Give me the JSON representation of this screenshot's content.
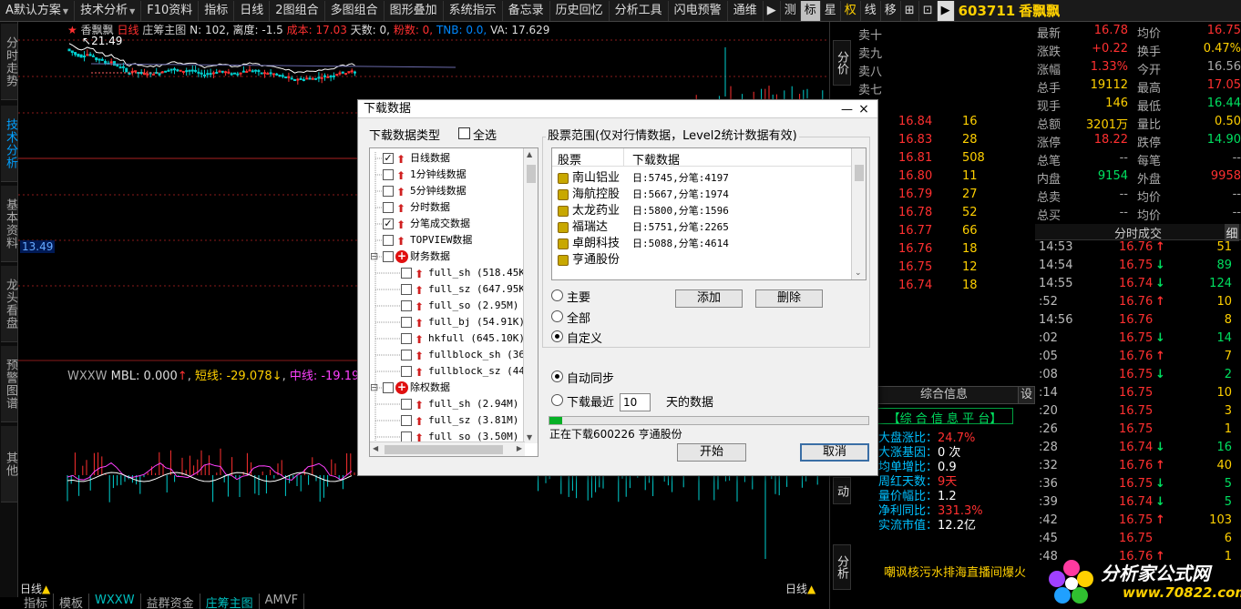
{
  "toolbar": {
    "items": [
      "A默认方案",
      "技术分析",
      "F10资料",
      "指标",
      "日线",
      "2图组合",
      "多图组合",
      "图形叠加",
      "系统指示",
      "备忘录",
      "历史回忆",
      "分析工具",
      "闪电预警",
      "通维"
    ],
    "mode_buttons": [
      "测",
      "标",
      "星",
      "权",
      "线",
      "移"
    ],
    "stock_code": "603711",
    "stock_name": "香飘飘"
  },
  "left_tabs": [
    "分时走势",
    "技术分析",
    "基本资料",
    "龙头看盘",
    "预警图谱",
    "其他"
  ],
  "chart": {
    "legend": {
      "name": "香飘飘",
      "period": "日线",
      "indicator": "庄筹主图",
      "n": "N: 102,",
      "height": "离度: -1.5",
      "cost": "成本: 17.03",
      "days": "天数: 0,",
      "fans": "粉数: 0,",
      "tnb": "TNB: 0.0,",
      "va": "VA: 17.629"
    },
    "high_label": "21.49",
    "left_price": "13.49",
    "ind_legend": {
      "name": "WXXW",
      "mbl": "MBL: 0.000",
      "short": "短线: -29.078",
      "mid": "中线: -19.194"
    },
    "period_label": "日线",
    "colors": {
      "up": "#ff3030",
      "down": "#00d0d0",
      "ma": "#ffffff",
      "grid": "#8a1a1a"
    }
  },
  "bottom_tabs": [
    "指标",
    "模板",
    "WXXW",
    "益群资金",
    "庄筹主图",
    "AMVF"
  ],
  "axis_labels": [
    "分价",
    "动",
    "分析"
  ],
  "orderbook": {
    "sell_labels": [
      "卖十",
      "卖九",
      "卖八",
      "卖七"
    ],
    "rows": [
      {
        "price": "16.84",
        "vol": "16"
      },
      {
        "price": "16.83",
        "vol": "28"
      },
      {
        "price": "16.81",
        "vol": "508"
      },
      {
        "price": "16.80",
        "vol": "11"
      },
      {
        "price": "16.79",
        "vol": "27"
      },
      {
        "price": "16.78",
        "vol": "52"
      },
      {
        "price": "16.77",
        "vol": "66"
      },
      {
        "price": "16.76",
        "vol": "18"
      },
      {
        "price": "16.75",
        "vol": "12"
      },
      {
        "price": "16.74",
        "vol": "18"
      }
    ]
  },
  "quote": {
    "rows": [
      {
        "l1": "最新",
        "v1": "16.78",
        "c1": "#ff3030",
        "l2": "均价",
        "v2": "16.75",
        "c2": "#ff3030"
      },
      {
        "l1": "涨跌",
        "v1": "+0.22",
        "c1": "#ff3030",
        "l2": "换手",
        "v2": "0.47%",
        "c2": "#ffd000"
      },
      {
        "l1": "涨幅",
        "v1": "1.33%",
        "c1": "#ff3030",
        "l2": "今开",
        "v2": "16.56",
        "c2": "#aaaaaa"
      },
      {
        "l1": "总手",
        "v1": "19112",
        "c1": "#ffd000",
        "l2": "最高",
        "v2": "17.05",
        "c2": "#ff3030"
      },
      {
        "l1": "现手",
        "v1": "146",
        "c1": "#ffd000",
        "l2": "最低",
        "v2": "16.44",
        "c2": "#00e060"
      },
      {
        "l1": "总额",
        "v1": "3201万",
        "c1": "#ffd000",
        "l2": "量比",
        "v2": "0.50",
        "c2": "#ffd000"
      },
      {
        "l1": "涨停",
        "v1": "18.22",
        "c1": "#ff3030",
        "l2": "跌停",
        "v2": "14.90",
        "c2": "#00e060"
      },
      {
        "l1": "总笔",
        "v1": "--",
        "c1": "#aaaaaa",
        "l2": "每笔",
        "v2": "--",
        "c2": "#aaaaaa"
      },
      {
        "l1": "内盘",
        "v1": "9154",
        "c1": "#00e060",
        "l2": "外盘",
        "v2": "9958",
        "c2": "#ff3030"
      },
      {
        "l1": "总卖",
        "v1": "--",
        "c1": "#aaaaaa",
        "l2": "均价",
        "v2": "--",
        "c2": "#aaaaaa"
      },
      {
        "l1": "总买",
        "v1": "--",
        "c1": "#aaaaaa",
        "l2": "均价",
        "v2": "--",
        "c2": "#aaaaaa"
      }
    ]
  },
  "ticks": {
    "title": "分时成交",
    "detail_label": "细",
    "rows": [
      {
        "t": "14:53",
        "p": "16.76",
        "d": "↑",
        "v": "51"
      },
      {
        "t": "14:54",
        "p": "16.75",
        "d": "↓",
        "v": "89"
      },
      {
        "t": "14:55",
        "p": "16.74",
        "d": "↓",
        "v": "124"
      },
      {
        "t": ":52",
        "p": "16.76",
        "d": "↑",
        "v": "10"
      },
      {
        "t": "14:56",
        "p": "16.76",
        "d": "",
        "v": "8"
      },
      {
        "t": ":02",
        "p": "16.75",
        "d": "↓",
        "v": "14"
      },
      {
        "t": ":05",
        "p": "16.76",
        "d": "↑",
        "v": "7"
      },
      {
        "t": ":08",
        "p": "16.75",
        "d": "↓",
        "v": "2"
      },
      {
        "t": ":14",
        "p": "16.75",
        "d": "",
        "v": "10"
      },
      {
        "t": ":20",
        "p": "16.75",
        "d": "",
        "v": "3"
      },
      {
        "t": ":26",
        "p": "16.75",
        "d": "",
        "v": "1"
      },
      {
        "t": ":28",
        "p": "16.74",
        "d": "↓",
        "v": "16"
      },
      {
        "t": ":32",
        "p": "16.76",
        "d": "↑",
        "v": "40"
      },
      {
        "t": ":36",
        "p": "16.75",
        "d": "↓",
        "v": "5"
      },
      {
        "t": ":39",
        "p": "16.74",
        "d": "↓",
        "v": "5"
      },
      {
        "t": ":42",
        "p": "16.75",
        "d": "↑",
        "v": "103"
      },
      {
        "t": ":45",
        "p": "16.75",
        "d": "",
        "v": "6"
      },
      {
        "t": ":48",
        "p": "16.76",
        "d": "↑",
        "v": "1"
      }
    ]
  },
  "info": {
    "header": "综合信息",
    "settings_label": "设",
    "platform_title": "【综 合 信 息 平 台】",
    "rows": [
      {
        "label": "大盘涨比：",
        "value": "24.7%",
        "c": "#ff3030"
      },
      {
        "label": "大涨基因：",
        "value": "0 次",
        "c": "#ffffff"
      },
      {
        "label": "均单增比：",
        "value": "0.9",
        "c": "#ffffff"
      },
      {
        "label": "周红天数：",
        "value": "9天",
        "c": "#ff3030"
      },
      {
        "label": "量价幅比：",
        "value": "1.2",
        "c": "#ffffff"
      },
      {
        "label": "净利同比：",
        "value": "331.3%",
        "c": "#ff3030"
      },
      {
        "label": "实流市值：",
        "value": "12.2亿",
        "c": "#ffffff"
      }
    ],
    "news": "嘲讽核污水排海直播间爆火"
  },
  "dialog": {
    "title": "下载数据",
    "min_label": "—",
    "close_label": "×",
    "type_label": "下载数据类型",
    "select_all": "全选",
    "tree": [
      {
        "text": "日线数据",
        "level": 1,
        "checked": true,
        "icon": "up"
      },
      {
        "text": "1分钟线数据",
        "level": 1,
        "checked": false,
        "icon": "up"
      },
      {
        "text": "5分钟线数据",
        "level": 1,
        "checked": false,
        "icon": "up"
      },
      {
        "text": "分时数据",
        "level": 1,
        "checked": false,
        "icon": "up"
      },
      {
        "text": "分笔成交数据",
        "level": 1,
        "checked": true,
        "icon": "up"
      },
      {
        "text": "TOPVIEW数据",
        "level": 1,
        "checked": false,
        "icon": "up"
      },
      {
        "text": "财务数据",
        "level": 1,
        "checked": false,
        "icon": "plus",
        "expand": true
      },
      {
        "text": "full_sh (518.45K)",
        "level": 2,
        "checked": false,
        "icon": "up"
      },
      {
        "text": "full_sz (647.95K)",
        "level": 2,
        "checked": false,
        "icon": "up"
      },
      {
        "text": "full_so (2.95M)",
        "level": 2,
        "checked": false,
        "icon": "up"
      },
      {
        "text": "full_bj (54.91K)",
        "level": 2,
        "checked": false,
        "icon": "up"
      },
      {
        "text": "hkfull (645.10K)",
        "level": 2,
        "checked": false,
        "icon": "up"
      },
      {
        "text": "fullblock_sh (36",
        "level": 2,
        "checked": false,
        "icon": "up"
      },
      {
        "text": "fullblock_sz (44",
        "level": 2,
        "checked": false,
        "icon": "up"
      },
      {
        "text": "除权数据",
        "level": 1,
        "checked": false,
        "icon": "plus",
        "expand": true
      },
      {
        "text": "full_sh (2.94M)",
        "level": 2,
        "checked": false,
        "icon": "up"
      },
      {
        "text": "full_sz (3.81M)",
        "level": 2,
        "checked": false,
        "icon": "up"
      },
      {
        "text": "full_so (3.50M)",
        "level": 2,
        "checked": false,
        "icon": "up"
      }
    ],
    "range_label": "股票范围(仅对行情数据，Level2统计数据有效)",
    "list_head": {
      "stock": "股票",
      "data": "下载数据"
    },
    "stocks": [
      {
        "name": "南山铝业",
        "data": "日:5745,分笔:4197"
      },
      {
        "name": "海航控股",
        "data": "日:5667,分笔:1974"
      },
      {
        "name": "太龙药业",
        "data": "日:5800,分笔:1596"
      },
      {
        "name": "福瑞达",
        "data": "日:5751,分笔:2265"
      },
      {
        "name": "卓朗科技",
        "data": "日:5088,分笔:4614"
      },
      {
        "name": "亨通股份",
        "data": ""
      }
    ],
    "radios": [
      {
        "label": "主要",
        "on": false
      },
      {
        "label": "全部",
        "on": false
      },
      {
        "label": "自定义",
        "on": true
      }
    ],
    "add_label": "添加",
    "del_label": "删除",
    "auto_sync": "自动同步",
    "recent_label": "下载最近",
    "recent_days": "10",
    "days_suffix": "天的数据",
    "progress": 0.04,
    "status": "正在下载600226 亨通股份",
    "start_label": "开始",
    "cancel_label": "取消"
  },
  "watermark": {
    "text": "分析家公式网",
    "url": "www.70822.com"
  }
}
